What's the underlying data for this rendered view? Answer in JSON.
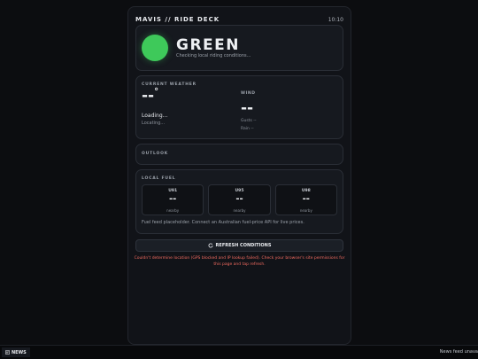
{
  "app": {
    "title": "MAVIS // RIDE DECK",
    "time": "10:10"
  },
  "status": {
    "word": "GREEN",
    "subtext": "Checking local riding conditions...",
    "color": "#3ec95a"
  },
  "weather": {
    "section_title": "CURRENT WEATHER",
    "temp": "--",
    "temp_unit": "°",
    "description": "Loading...",
    "location": "Locating...",
    "wind_title": "WIND",
    "wind_value": "--",
    "gusts": "Gusts --",
    "rain": "Rain --"
  },
  "outlook": {
    "section_title": "OUTLOOK"
  },
  "fuel": {
    "section_title": "LOCAL FUEL",
    "items": [
      {
        "grade": "U91",
        "price": "--",
        "sub": "nearby"
      },
      {
        "grade": "U95",
        "price": "--",
        "sub": "nearby"
      },
      {
        "grade": "U98",
        "price": "--",
        "sub": "nearby"
      }
    ],
    "note": "Fuel feed placeholder. Connect an Australian fuel-price API for live prices."
  },
  "refresh": {
    "icon": "refresh-icon",
    "label": "REFRESH CONDITIONS"
  },
  "error": "Couldn't determine location (GPS blocked and IP lookup failed). Check your browser's site permissions for this page and tap refresh.",
  "bottom_bar": {
    "news_label": "NEWS",
    "news_icon": "news-icon",
    "ticker": "News feed unava"
  }
}
